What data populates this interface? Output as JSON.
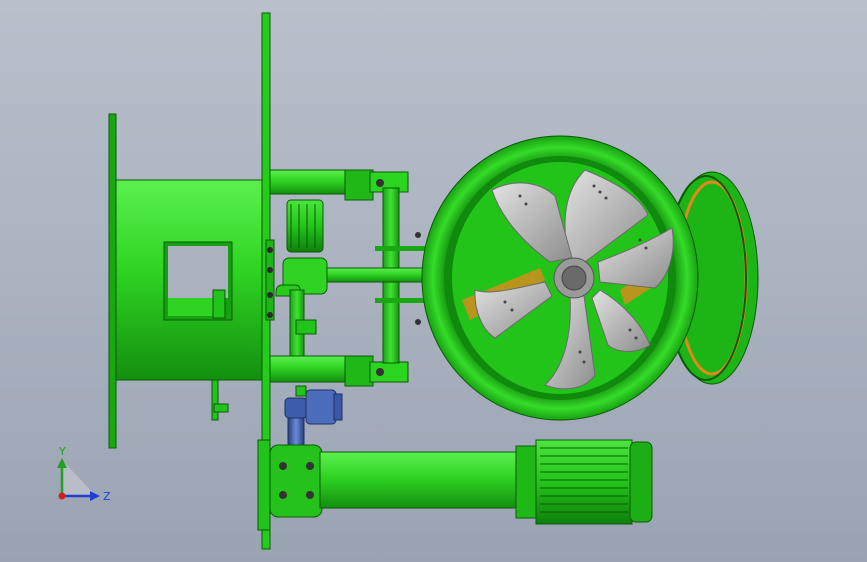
{
  "viewport": {
    "background_top": "#b9c0cc",
    "background_bottom": "#9aa3b2"
  },
  "model": {
    "body_color": "#22d41c",
    "body_shade": "#12a10e",
    "pipe_color": "#3f5fb0",
    "blade_color": "#bcbcbc",
    "accent_color": "#e08a1e"
  },
  "triad": {
    "y_label": "Y",
    "z_label": "Z",
    "y_color": "#21a121",
    "z_color": "#1f3fd0",
    "origin_color": "#d01f1f"
  }
}
